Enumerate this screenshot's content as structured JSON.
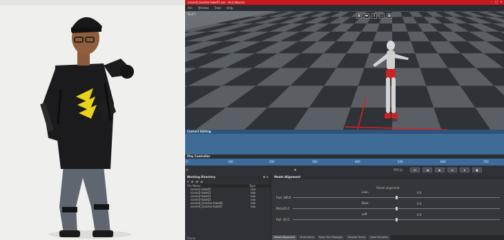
{
  "window": {
    "title": "scene4_teacher-take07.cas - Axis Neuron",
    "controls": [
      "–",
      "□",
      "×"
    ]
  },
  "menu": {
    "items": [
      "File",
      "Window",
      "Tools",
      "Help"
    ]
  },
  "viewport": {
    "label": "Top(F)",
    "tools": [
      "▦",
      "▬",
      "↕",
      "▢",
      "▦"
    ]
  },
  "contact_editing": {
    "title": "Contact Editing"
  },
  "play_controller": {
    "title": "Play Controller",
    "ruler_ticks": [
      "0",
      "100",
      "200",
      "300",
      "400",
      "500",
      "600",
      "700"
    ],
    "frame": "0",
    "pause": "⏸",
    "fps_label": "FPS 1x",
    "buttons": [
      "⏮",
      "◀",
      "▶",
      "⏭",
      "⏹",
      "●"
    ]
  },
  "working_directory": {
    "title": "Working Directory",
    "header_icons": "⊡ ✕",
    "tool_icons": [
      "▾",
      "▰",
      "▰",
      "▰"
    ],
    "columns": [
      "File Name",
      "Type"
    ],
    "files": [
      {
        "name": "scene1-take01",
        "type": "raw"
      },
      {
        "name": "scene2-take01",
        "type": "raw"
      },
      {
        "name": "scene3-take01",
        "type": "raw"
      },
      {
        "name": "scene3-take02",
        "type": "raw"
      },
      {
        "name": "scene4_teacher-take06",
        "type": "raw"
      },
      {
        "name": "scene4_teacher-take07",
        "type": "raw"
      }
    ],
    "status": "Ready"
  },
  "model_alignment": {
    "title": "Model Alignment",
    "subtitle": "Model alignment",
    "sliders": [
      {
        "label": "Lean",
        "value_text": "0.0",
        "name": "Fwd",
        "num": "180.0",
        "level": 0.5
      },
      {
        "label": "Back",
        "value_text": "0.0",
        "name": "Pitch",
        "num": "45.0",
        "level": 0.5
      },
      {
        "label": "Left",
        "value_text": "0.0",
        "name": "Roll",
        "num": "45.0",
        "level": 0.5
      }
    ],
    "tabs": [
      "Model Alignment",
      "Parameters",
      "Body Size Manager",
      "Smooth Factor",
      "Data Visualize"
    ],
    "active_tab": 0
  },
  "colors": {
    "titlebar": "#c8191f",
    "timeline": "#3a6b9a",
    "contact_panel": "#3f6c96"
  }
}
